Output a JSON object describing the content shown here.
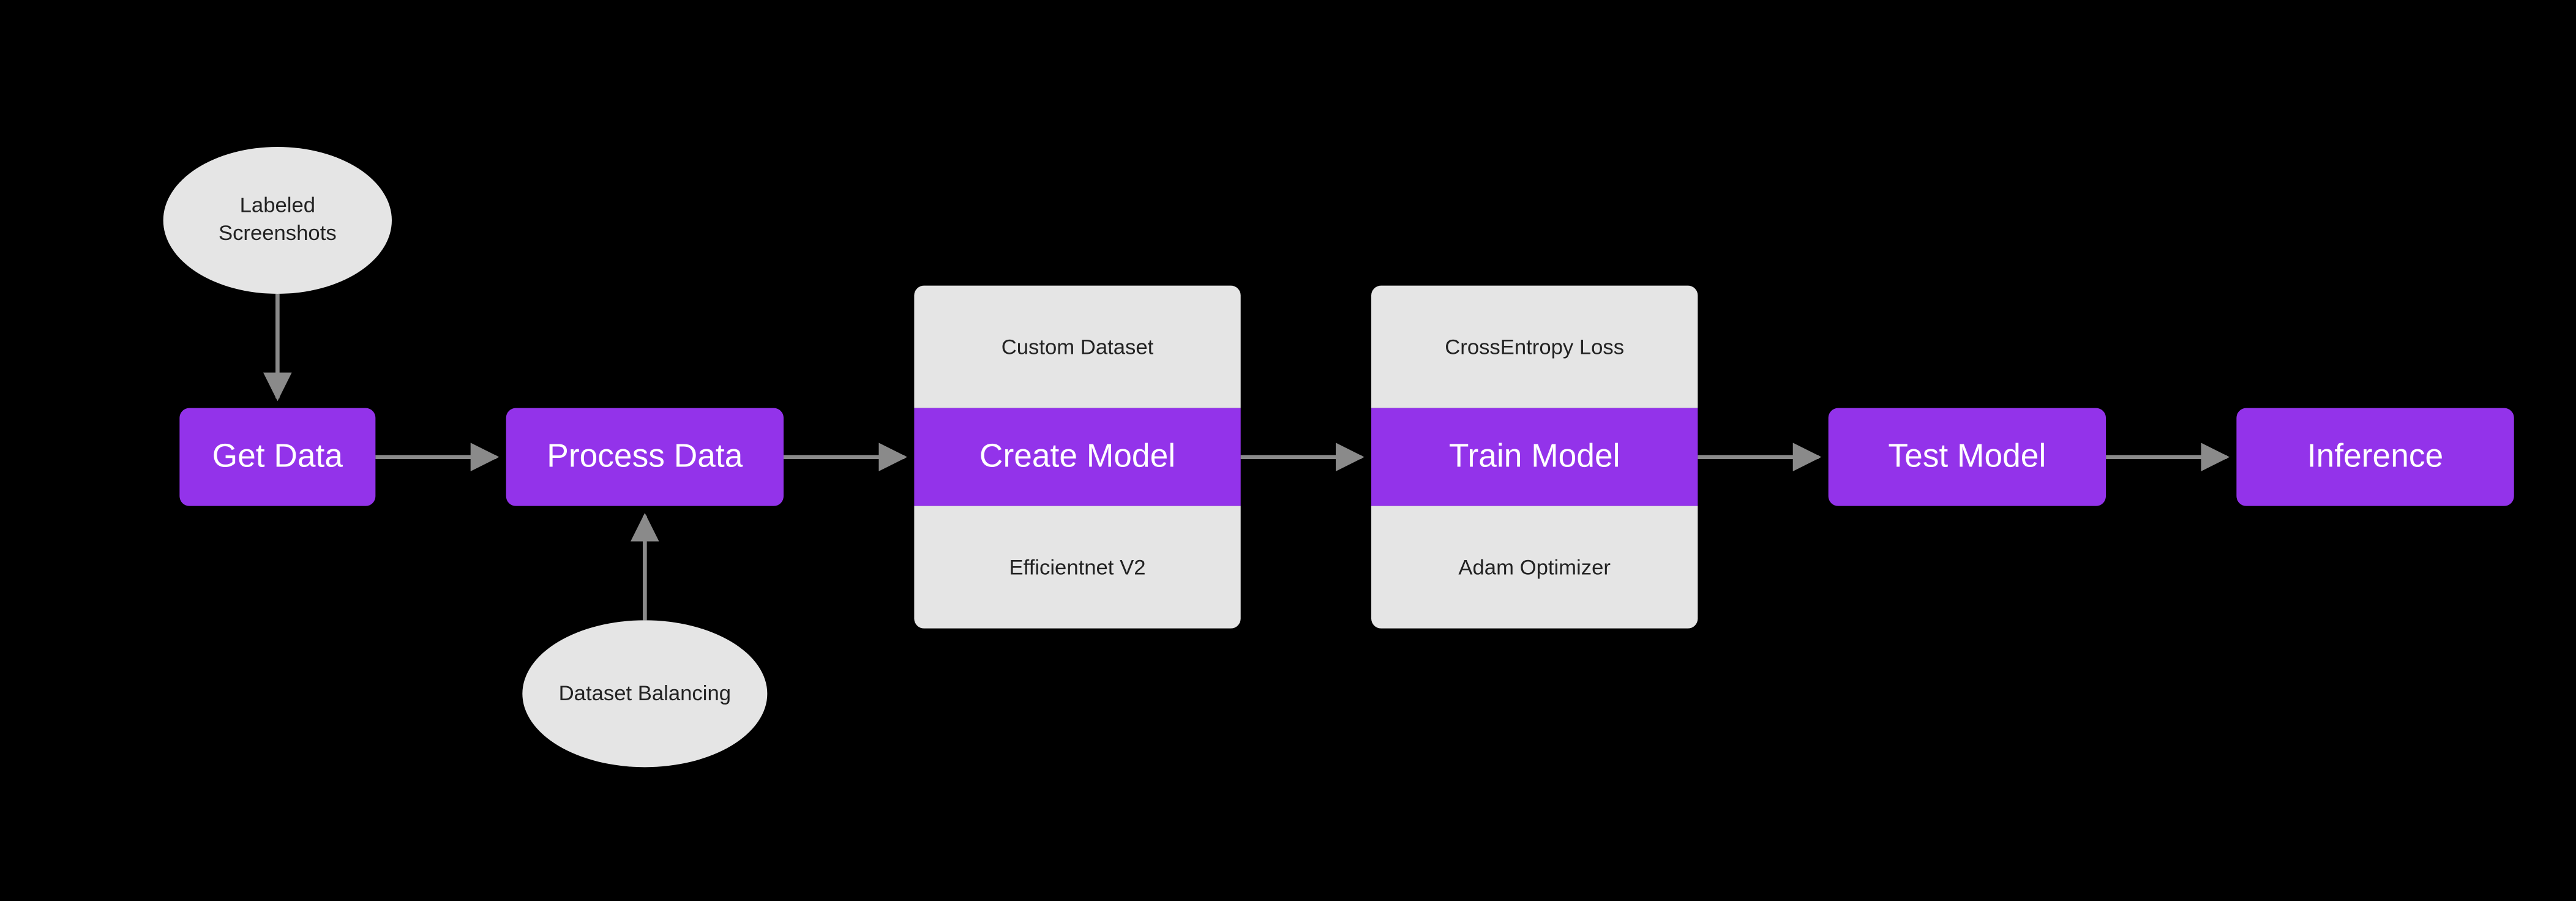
{
  "colors": {
    "primary": "#9333EA",
    "secondary": "#E5E5E5",
    "background": "#000000",
    "arrow": "#8A8A8A"
  },
  "steps": {
    "get_data": "Get Data",
    "process_data": "Process Data",
    "create_model": "Create Model",
    "train_model": "Train Model",
    "test_model": "Test Model",
    "inference": "Inference"
  },
  "annotations": {
    "labeled_screenshots_line1": "Labeled",
    "labeled_screenshots_line2": "Screenshots",
    "dataset_balancing": "Dataset Balancing",
    "custom_dataset": "Custom Dataset",
    "efficientnet_v2": "Efficientnet V2",
    "crossentropy_loss": "CrossEntropy Loss",
    "adam_optimizer": "Adam Optimizer"
  }
}
